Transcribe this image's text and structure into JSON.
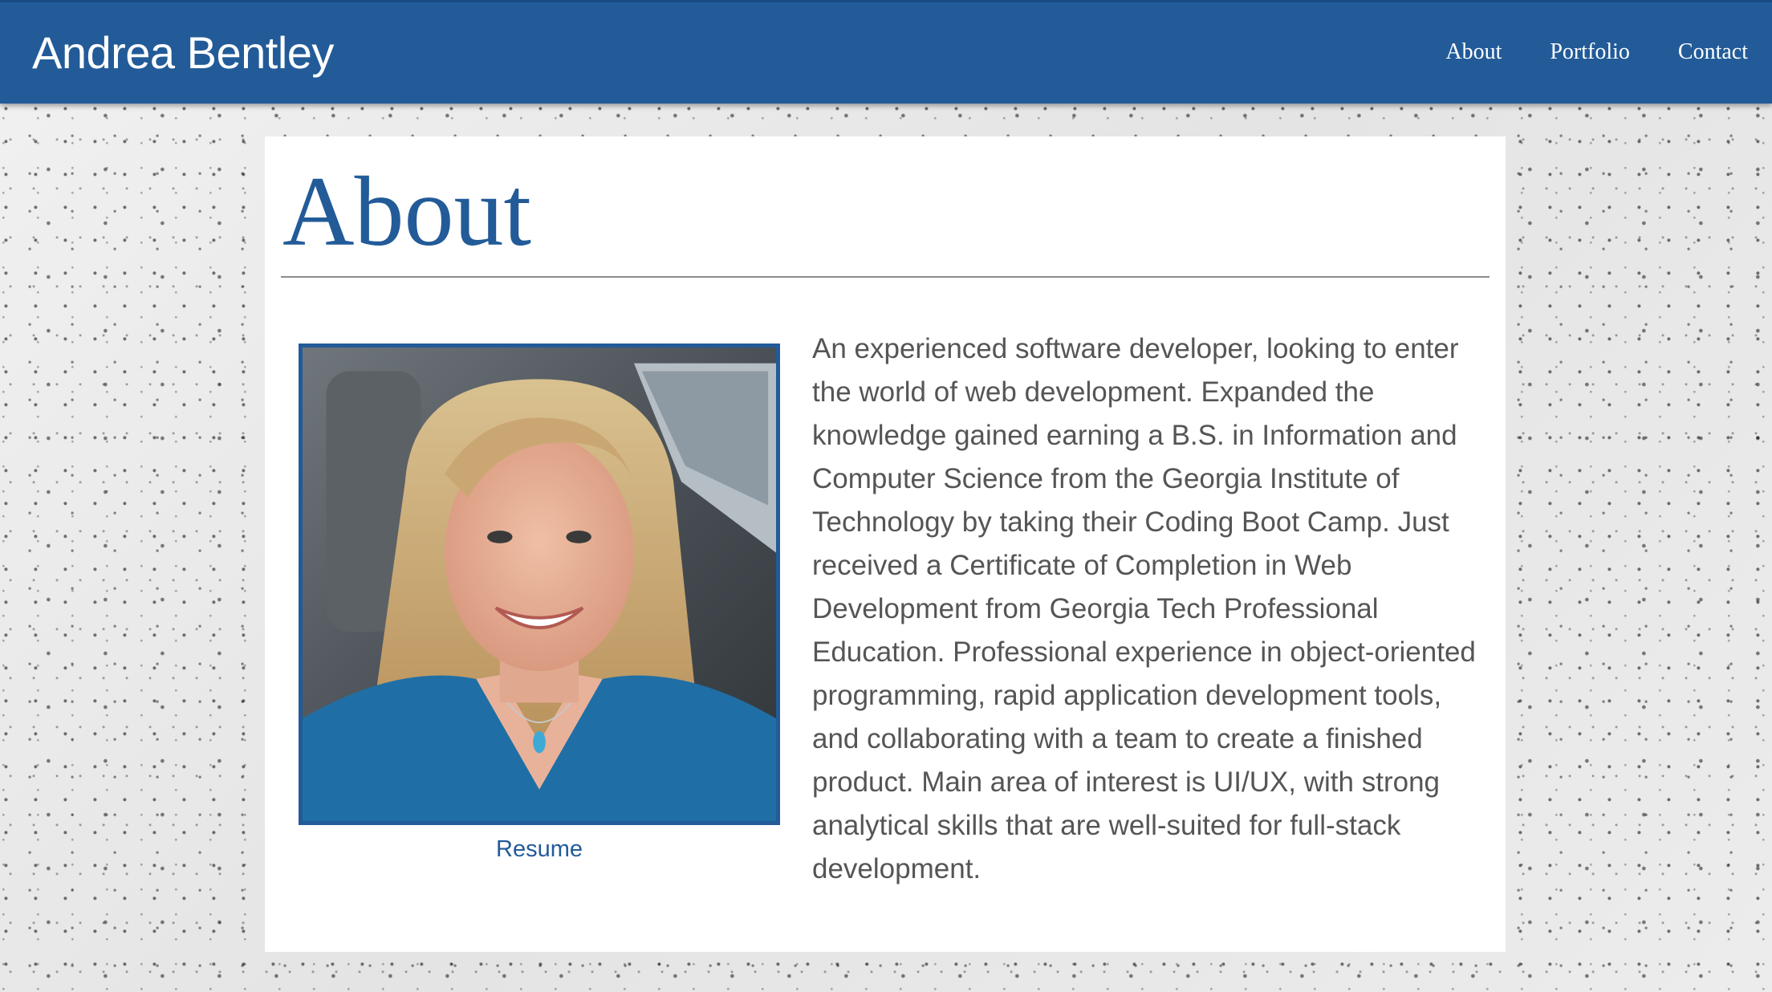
{
  "navbar": {
    "brand": "Andrea Bentley",
    "links": [
      {
        "label": "About"
      },
      {
        "label": "Portfolio"
      },
      {
        "label": "Contact"
      }
    ],
    "color": "#225b98"
  },
  "main": {
    "title": "About",
    "photo": {
      "icon": "profile-photo"
    },
    "resume_link": "Resume",
    "bio": "An experienced software developer, looking to enter the world of web development. Expanded the knowledge gained earning a B.S. in Information and Computer Science from the Georgia Institute of Technology by taking their Coding Boot Camp. Just received a Certificate of Completion in Web Development from Georgia Tech Professional Education. Professional experience in object-oriented programming, rapid application development tools, and collaborating with a team to create a finished product. Main area of interest is UI/UX, with strong analytical skills that are well-suited for full-stack development."
  }
}
